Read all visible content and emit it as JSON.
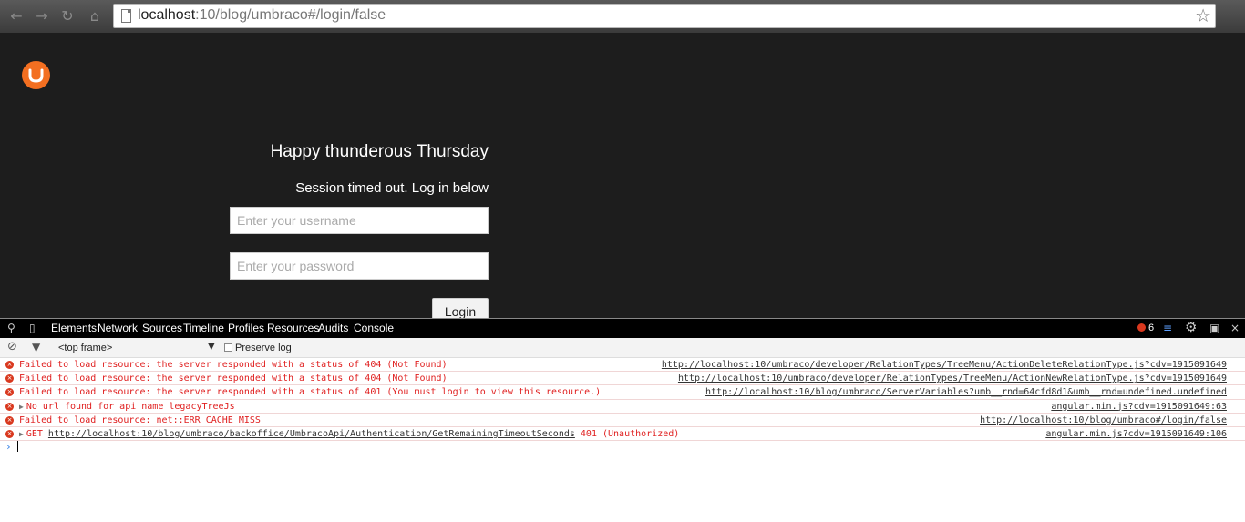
{
  "browser": {
    "url_host": "localhost",
    "url_path": ":10/blog/umbraco#/login/false"
  },
  "login": {
    "greeting": "Happy thunderous Thursday",
    "session_message": "Session timed out. Log in below",
    "username_placeholder": "Enter your username",
    "password_placeholder": "Enter your password",
    "login_label": "Login"
  },
  "devtools": {
    "tabs": [
      "Elements",
      "Network",
      "Sources",
      "Timeline",
      "Profiles",
      "Resources",
      "Audits",
      "Console"
    ],
    "error_count": "6",
    "frame": "<top frame>",
    "preserve_log": "Preserve log",
    "messages": [
      {
        "text": "Failed to load resource: the server responded with a status of 404 (Not Found)",
        "source": "http://localhost:10/umbraco/developer/RelationTypes/TreeMenu/ActionDeleteRelationType.js?cdv=1915091649"
      },
      {
        "text": "Failed to load resource: the server responded with a status of 404 (Not Found)",
        "source": "http://localhost:10/umbraco/developer/RelationTypes/TreeMenu/ActionNewRelationType.js?cdv=1915091649"
      },
      {
        "text": "Failed to load resource: the server responded with a status of 401 (You must login to view this resource.)",
        "source": "http://localhost:10/blog/umbraco/ServerVariables?umb__rnd=64cfd8d1&umb__rnd=undefined.undefined"
      },
      {
        "text": "No url found for api name legacyTreeJs",
        "source": "angular.min.js?cdv=1915091649:63"
      },
      {
        "text": "Failed to load resource: net::ERR_CACHE_MISS",
        "source": "http://localhost:10/blog/umbraco#/login/false"
      },
      {
        "text_prefix": "GET ",
        "text_link": "http://localhost:10/blog/umbraco/backoffice/UmbracoApi/Authentication/GetRemainingTimeoutSeconds",
        "text_suffix": " 401 (Unauthorized)",
        "source": "angular.min.js?cdv=1915091649:106"
      }
    ]
  }
}
